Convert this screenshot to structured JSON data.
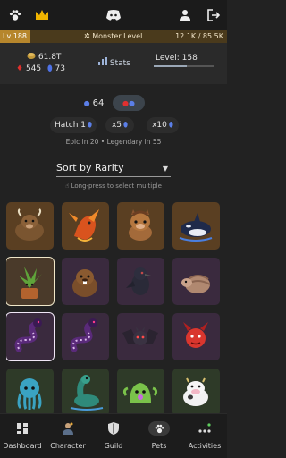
{
  "topbar": {
    "icons": [
      "paw-icon",
      "crown-icon",
      "discord-icon",
      "person-icon",
      "logout-icon"
    ]
  },
  "level_bar": {
    "level": "Lv 188",
    "monster_level_label": "Monster Level",
    "xp": "12.1K / 85.5K",
    "xp_fraction": 0.142
  },
  "stats": {
    "gold": "61.8T",
    "red_gems": "545",
    "blue_gems": "73",
    "stats_label": "Stats",
    "level_label": "Level: 158",
    "level_fraction": 0.55
  },
  "pet_actions": {
    "blue_count": "64",
    "hatch_label": "Hatch 1",
    "x5_label": "x5",
    "x10_label": "x10",
    "rarity_note": "Epic in 20 • Legendary in 55"
  },
  "sort": {
    "selected": "Sort by Rarity",
    "hint": "Long-press to select multiple"
  },
  "pets": [
    {
      "name": "bull",
      "bg": "#5a3f22"
    },
    {
      "name": "dragon",
      "bg": "#5a3f22"
    },
    {
      "name": "horse",
      "bg": "#5a3f22"
    },
    {
      "name": "orca",
      "bg": "#5a3f22"
    },
    {
      "name": "plant",
      "bg": "#4a3a2a"
    },
    {
      "name": "beaver",
      "bg": "#3a2a3e"
    },
    {
      "name": "crow",
      "bg": "#3a2a3e"
    },
    {
      "name": "armadillo",
      "bg": "#3a2a3e"
    },
    {
      "name": "snake",
      "bg": "#3a2a3e"
    },
    {
      "name": "snake",
      "bg": "#3a2a3e"
    },
    {
      "name": "bat",
      "bg": "#3a2a3e"
    },
    {
      "name": "devil",
      "bg": "#3a2a3e"
    },
    {
      "name": "octopus",
      "bg": "#2e3a28"
    },
    {
      "name": "nessie",
      "bg": "#2e3a28"
    },
    {
      "name": "slime",
      "bg": "#2e3a28"
    },
    {
      "name": "cow",
      "bg": "#2e3a28"
    }
  ],
  "nav": [
    {
      "label": "Dashboard",
      "icon": "dashboard-icon"
    },
    {
      "label": "Character",
      "icon": "character-icon"
    },
    {
      "label": "Guild",
      "icon": "shield-icon"
    },
    {
      "label": "Pets",
      "icon": "paw-icon"
    },
    {
      "label": "Activities",
      "icon": "dots-icon"
    }
  ]
}
